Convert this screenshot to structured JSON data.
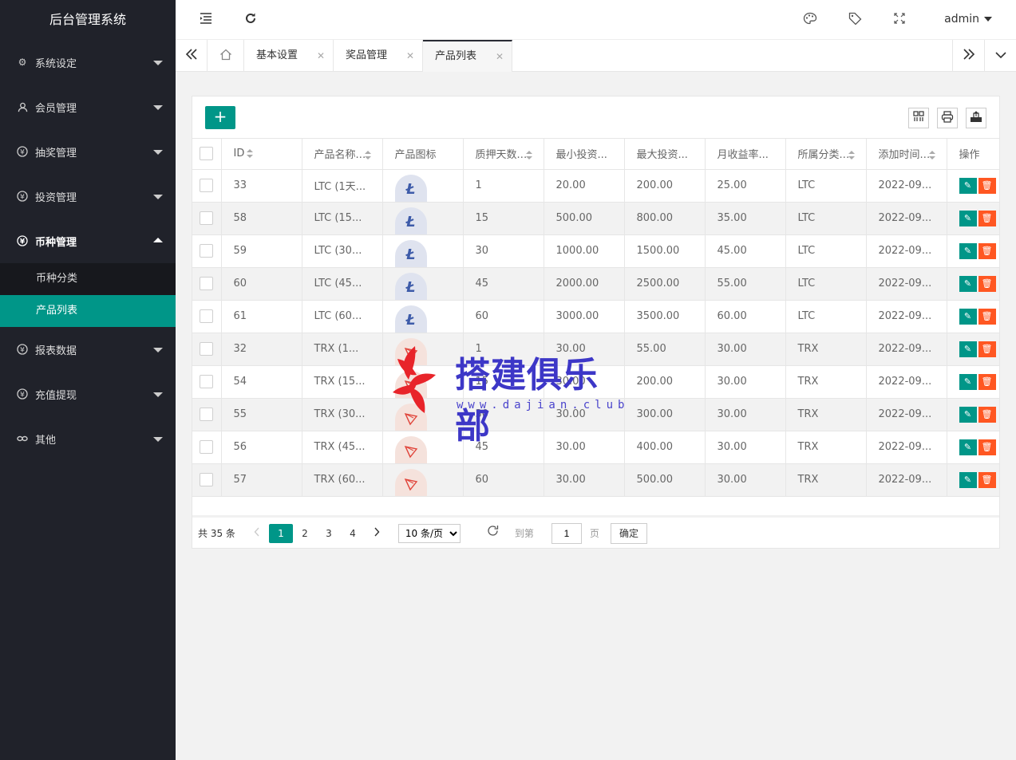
{
  "app": {
    "title": "后台管理系统"
  },
  "header": {
    "user": "admin"
  },
  "sidebar": {
    "items": [
      {
        "label": "系统设定",
        "icon": "gear-icon"
      },
      {
        "label": "会员管理",
        "icon": "user-icon"
      },
      {
        "label": "抽奖管理",
        "icon": "yen-icon"
      },
      {
        "label": "投资管理",
        "icon": "yen-icon"
      },
      {
        "label": "币种管理",
        "icon": "yen-icon"
      },
      {
        "label": "报表数据",
        "icon": "yen-icon"
      },
      {
        "label": "充值提现",
        "icon": "yen-icon"
      },
      {
        "label": "其他",
        "icon": "link-icon"
      }
    ],
    "sub_items": [
      "币种分类",
      "产品列表"
    ]
  },
  "tabs": [
    {
      "label": "基本设置"
    },
    {
      "label": "奖品管理"
    },
    {
      "label": "产品列表"
    }
  ],
  "table": {
    "columns": [
      "ID",
      "产品名称",
      "产品图标",
      "质押天数",
      "最小投资",
      "最大投资",
      "月收益率",
      "所属分类",
      "添加时间",
      "操作"
    ],
    "rows": [
      {
        "id": "33",
        "name": "LTC (1天...",
        "coin": "ltc",
        "days": "1",
        "min": "20.00",
        "max": "200.00",
        "rate": "25.00",
        "cat": "LTC",
        "time": "2022-09..."
      },
      {
        "id": "58",
        "name": "LTC (15...",
        "coin": "ltc",
        "days": "15",
        "min": "500.00",
        "max": "800.00",
        "rate": "35.00",
        "cat": "LTC",
        "time": "2022-09..."
      },
      {
        "id": "59",
        "name": "LTC (30...",
        "coin": "ltc",
        "days": "30",
        "min": "1000.00",
        "max": "1500.00",
        "rate": "45.00",
        "cat": "LTC",
        "time": "2022-09..."
      },
      {
        "id": "60",
        "name": "LTC (45...",
        "coin": "ltc",
        "days": "45",
        "min": "2000.00",
        "max": "2500.00",
        "rate": "55.00",
        "cat": "LTC",
        "time": "2022-09..."
      },
      {
        "id": "61",
        "name": "LTC (60...",
        "coin": "ltc",
        "days": "60",
        "min": "3000.00",
        "max": "3500.00",
        "rate": "60.00",
        "cat": "LTC",
        "time": "2022-09..."
      },
      {
        "id": "32",
        "name": "TRX (1...",
        "coin": "trx",
        "days": "1",
        "min": "30.00",
        "max": "55.00",
        "rate": "30.00",
        "cat": "TRX",
        "time": "2022-09..."
      },
      {
        "id": "54",
        "name": "TRX (15...",
        "coin": "trx",
        "days": "15",
        "min": "30.00",
        "max": "200.00",
        "rate": "30.00",
        "cat": "TRX",
        "time": "2022-09..."
      },
      {
        "id": "55",
        "name": "TRX (30...",
        "coin": "trx",
        "days": "30",
        "min": "30.00",
        "max": "300.00",
        "rate": "30.00",
        "cat": "TRX",
        "time": "2022-09..."
      },
      {
        "id": "56",
        "name": "TRX (45...",
        "coin": "trx",
        "days": "45",
        "min": "30.00",
        "max": "400.00",
        "rate": "30.00",
        "cat": "TRX",
        "time": "2022-09..."
      },
      {
        "id": "57",
        "name": "TRX (60...",
        "coin": "trx",
        "days": "60",
        "min": "30.00",
        "max": "500.00",
        "rate": "30.00",
        "cat": "TRX",
        "time": "2022-09..."
      }
    ]
  },
  "pager": {
    "total": "共 35 条",
    "pages": [
      "1",
      "2",
      "3",
      "4"
    ],
    "page_size": "10 条/页",
    "goto_label": "到第",
    "goto_value": "1",
    "page_unit": "页",
    "confirm": "确定"
  },
  "watermark": {
    "text": "搭建俱乐部",
    "url": "www.dajian.club"
  },
  "colors": {
    "accent": "#009688",
    "danger": "#ff5722",
    "sidebar": "#20222a"
  }
}
